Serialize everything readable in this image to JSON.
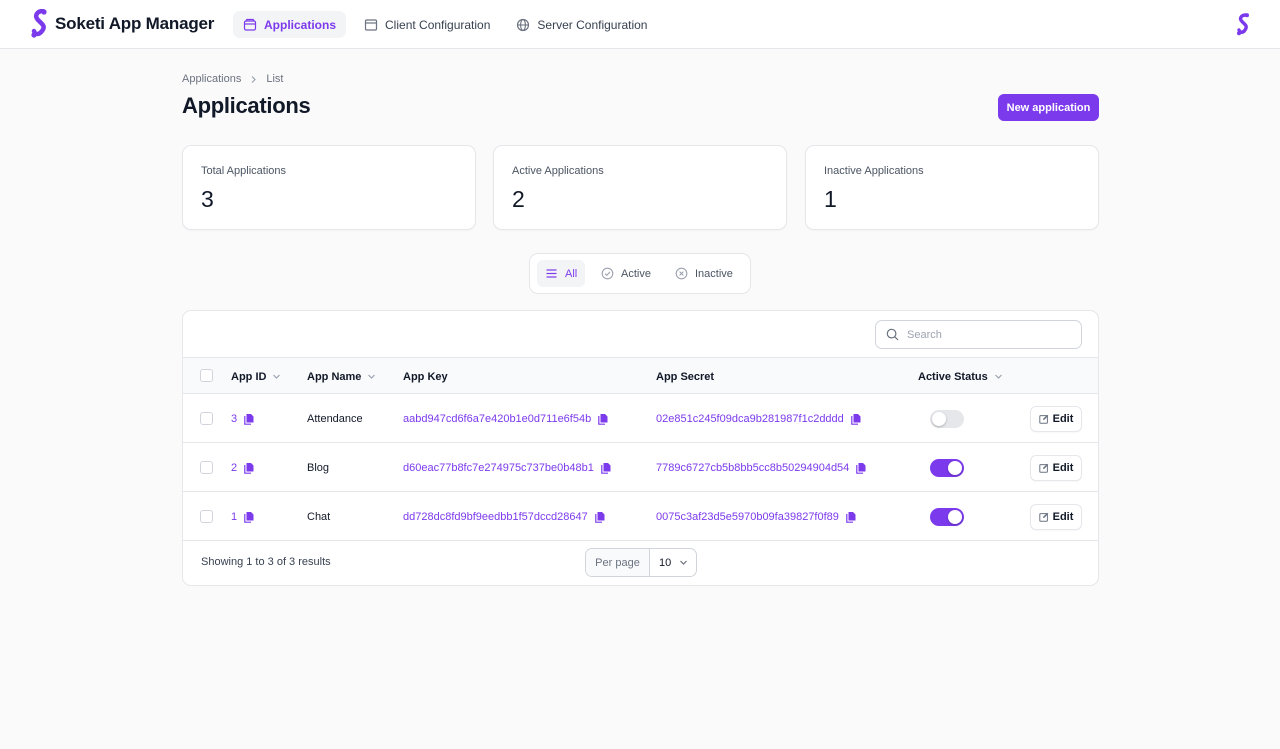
{
  "app": {
    "name": "Soketi App Manager",
    "accent_color": "#7c3aed",
    "logo_icon": "soketi-logo-icon"
  },
  "nav": [
    {
      "label": "Applications",
      "icon": "app-window-icon",
      "active": true
    },
    {
      "label": "Client Configuration",
      "icon": "browser-window-icon",
      "active": false
    },
    {
      "label": "Server Configuration",
      "icon": "globe-icon",
      "active": false
    }
  ],
  "breadcrumb": [
    "Applications",
    "List"
  ],
  "page": {
    "title": "Applications",
    "new_button": "New application"
  },
  "stats": [
    {
      "label": "Total Applications",
      "value": "3"
    },
    {
      "label": "Active Applications",
      "value": "2"
    },
    {
      "label": "Inactive Applications",
      "value": "1"
    }
  ],
  "filters": [
    {
      "label": "All",
      "icon": "list-icon",
      "active": true
    },
    {
      "label": "Active",
      "icon": "check-circle-icon",
      "active": false
    },
    {
      "label": "Inactive",
      "icon": "x-circle-icon",
      "active": false
    }
  ],
  "table": {
    "search_placeholder": "Search",
    "columns": {
      "app_id": "App ID",
      "app_name": "App Name",
      "app_key": "App Key",
      "app_secret": "App Secret",
      "active_status": "Active Status"
    },
    "edit_label": "Edit",
    "rows": [
      {
        "id": "3",
        "name": "Attendance",
        "key": "aabd947cd6f6a7e420b1e0d711e6f54b",
        "secret": "02e851c245f09dca9b281987f1c2dddd",
        "active": false
      },
      {
        "id": "2",
        "name": "Blog",
        "key": "d60eac77b8fc7e274975c737be0b48b1",
        "secret": "7789c6727cb5b8bb5cc8b50294904d54",
        "active": true
      },
      {
        "id": "1",
        "name": "Chat",
        "key": "dd728dc8fd9bf9eedbb1f57dccd28647",
        "secret": "0075c3af23d5e5970b09fa39827f0f89",
        "active": true
      }
    ],
    "footer": {
      "showing": "Showing 1 to 3 of 3 results",
      "per_page_label": "Per page",
      "per_page_value": "10"
    }
  }
}
